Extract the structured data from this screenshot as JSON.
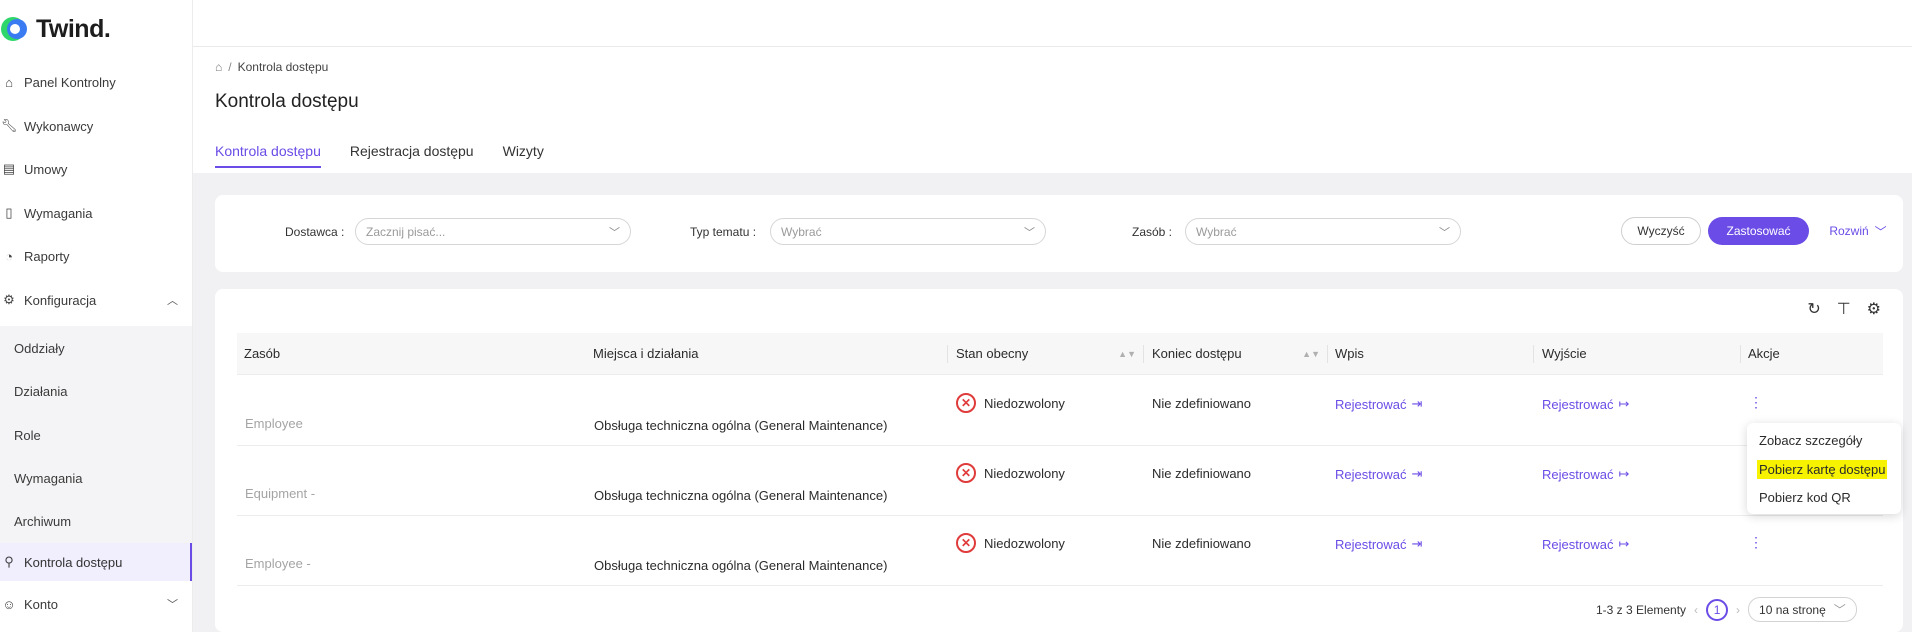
{
  "brand": {
    "name": "Twind."
  },
  "sidebar": {
    "items": [
      {
        "label": "Panel Kontrolny",
        "icon": "home-icon"
      },
      {
        "label": "Wykonawcy",
        "icon": "wrench-icon"
      },
      {
        "label": "Umowy",
        "icon": "document-icon"
      },
      {
        "label": "Wymagania",
        "icon": "file-icon"
      },
      {
        "label": "Raporty",
        "icon": "chart-icon"
      },
      {
        "label": "Konfiguracja",
        "icon": "gear-icon"
      }
    ],
    "sub_items": [
      {
        "label": "Oddziały"
      },
      {
        "label": "Działania"
      },
      {
        "label": "Role"
      },
      {
        "label": "Wymagania"
      },
      {
        "label": "Archiwum"
      }
    ],
    "active_item": {
      "label": "Kontrola dostępu",
      "icon": "key-icon"
    },
    "account_item": {
      "label": "Konto",
      "icon": "user-circle-icon"
    }
  },
  "breadcrumb": {
    "home_icon": "home-icon",
    "separator": "/",
    "current": "Kontrola dostępu"
  },
  "page": {
    "title": "Kontrola dostępu"
  },
  "tabs": [
    {
      "label": "Kontrola dostępu",
      "active": true
    },
    {
      "label": "Rejestracja dostępu",
      "active": false
    },
    {
      "label": "Wizyty",
      "active": false
    }
  ],
  "filters": {
    "supplier": {
      "label": "Dostawca :",
      "placeholder": "Zacznij pisać..."
    },
    "subject_type": {
      "label": "Typ tematu :",
      "placeholder": "Wybrać"
    },
    "resource": {
      "label": "Zasób :",
      "placeholder": "Wybrać"
    },
    "clear_label": "Wyczyść",
    "apply_label": "Zastosować",
    "expand_label": "Rozwiń"
  },
  "table": {
    "columns": [
      "Zasób",
      "Miejsca i działania",
      "Stan obecny",
      "Koniec dostępu",
      "Wpis",
      "Wyjście",
      "Akcje"
    ],
    "rows": [
      {
        "resource": "Employee",
        "places": "Obsługa techniczna ogólna (General Maintenance)",
        "status": "Niedozwolony",
        "end": "Nie zdefiniowano",
        "entry": "Rejestrować",
        "exit": "Rejestrować"
      },
      {
        "resource": "Equipment -",
        "places": "Obsługa techniczna ogólna (General Maintenance)",
        "status": "Niedozwolony",
        "end": "Nie zdefiniowano",
        "entry": "Rejestrować",
        "exit": "Rejestrować"
      },
      {
        "resource": "Employee -",
        "places": "Obsługa techniczna ogólna (General Maintenance)",
        "status": "Niedozwolony",
        "end": "Nie zdefiniowano",
        "entry": "Rejestrować",
        "exit": "Rejestrować"
      }
    ]
  },
  "actions_menu": {
    "items": [
      "Zobacz szczegóły",
      "Pobierz kartę dostępu",
      "Pobierz kod QR"
    ],
    "highlighted_index": 1
  },
  "pagination": {
    "summary": "1-3 z 3 Elementy",
    "current_page": "1",
    "per_page": "10 na stronę"
  },
  "colors": {
    "accent": "#6b4ce6",
    "danger": "#e03b3b",
    "highlight": "#f7f200",
    "content_bg": "#f1f1f4"
  }
}
